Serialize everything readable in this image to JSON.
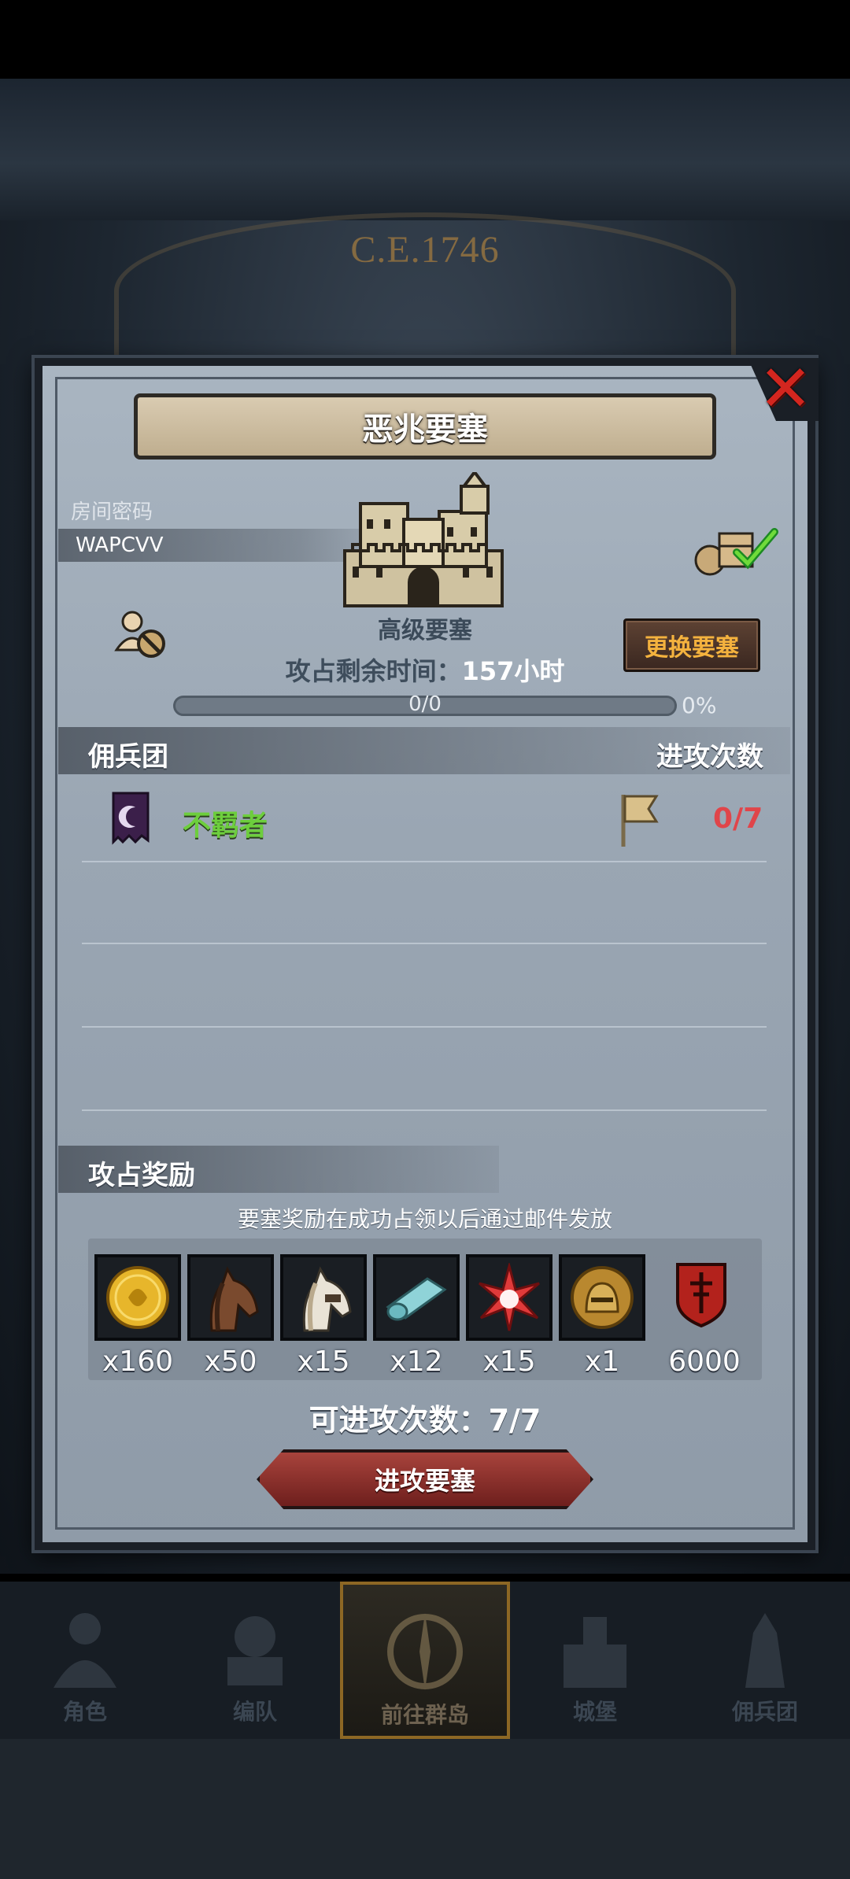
{
  "background": {
    "era": "C.E.1746"
  },
  "dialog": {
    "title": "恶兆要塞",
    "room_password_label": "房间密码",
    "room_password": "WAPCVV",
    "fortress_level": "高级要塞",
    "time_left_label": "攻占剩余时间：",
    "time_left_value": "157小时",
    "change_fortress": "更换要塞",
    "progress_text": "0/0",
    "progress_pct": "0%",
    "progress_fraction": 0
  },
  "mercenary_section": {
    "left_header": "佣兵团",
    "right_header": "进攻次数",
    "rows": [
      {
        "name": "不羁者",
        "attacks": "0/7"
      }
    ]
  },
  "rewards_section": {
    "header": "攻占奖励",
    "note": "要塞奖励在成功占领以后通过邮件发放",
    "items": [
      {
        "icon": "gold-coin-icon",
        "qty": "x160"
      },
      {
        "icon": "brown-horse-icon",
        "qty": "x50"
      },
      {
        "icon": "white-horse-icon",
        "qty": "x15"
      },
      {
        "icon": "cloth-roll-icon",
        "qty": "x12"
      },
      {
        "icon": "red-star-icon",
        "qty": "x15"
      },
      {
        "icon": "gold-helmet-icon",
        "qty": "x1"
      },
      {
        "icon": "red-shield-icon",
        "qty": "6000"
      }
    ]
  },
  "attacks_available_label": "可进攻次数：7/7",
  "attack_button": "进攻要塞",
  "nav": [
    {
      "label": "角色",
      "icon": "character-icon"
    },
    {
      "label": "编队",
      "icon": "formation-icon"
    },
    {
      "label": "前往群岛",
      "icon": "compass-icon"
    },
    {
      "label": "城堡",
      "icon": "castle-icon"
    },
    {
      "label": "佣兵团",
      "icon": "mercenary-icon"
    }
  ],
  "colors": {
    "accent_green": "#6dce3d",
    "accent_red": "#e0454a",
    "gold": "#f4b23e"
  }
}
